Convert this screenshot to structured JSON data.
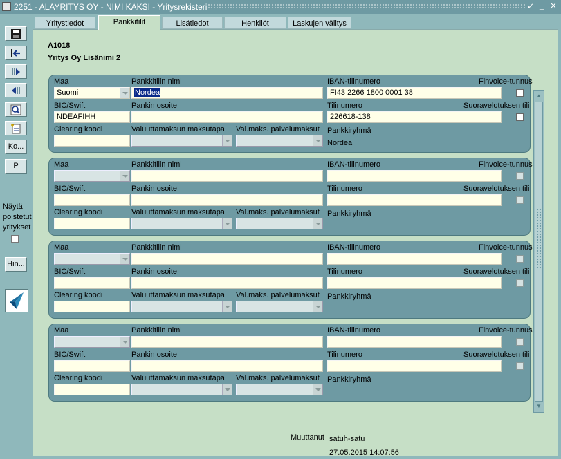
{
  "titlebar": {
    "title": "2251 - ALAYRITYS OY - NIMI KAKSI - Yritysrekisteri",
    "controls": [
      "↙",
      "_",
      "✕"
    ]
  },
  "toolbar": {
    "buttons": [
      {
        "name": "save-button",
        "icon": "save-icon"
      },
      {
        "name": "exit-button",
        "icon": "exit-icon"
      },
      {
        "name": "next-button",
        "icon": "forward-icon"
      },
      {
        "name": "back-button",
        "icon": "back-icon"
      },
      {
        "name": "search-button",
        "icon": "search-icon"
      },
      {
        "name": "new-record-button",
        "icon": "new-document-icon"
      }
    ],
    "ko_label": "Ko...",
    "p_label": "P",
    "show_deleted_label": "Näytä poistetut yritykset",
    "hin_label": "Hin..."
  },
  "tabs": [
    "Yritystiedot",
    "Pankkitilit",
    "Lisätiedot",
    "Henkilöt",
    "Laskujen välitys"
  ],
  "active_tab": 1,
  "header": {
    "code": "A1018",
    "name": "Yritys Oy Lisänimi 2"
  },
  "labels": {
    "maa": "Maa",
    "pankkitilin_nimi": "Pankkitilin nimi",
    "iban": "IBAN-tilinumero",
    "finvoice": "Finvoice-tunnus",
    "bic": "BIC/Swift",
    "pankin_osoite": "Pankin osoite",
    "tilinumero": "Tilinumero",
    "suoraveloitus": "Suoravelotuksen tili",
    "clearing": "Clearing koodi",
    "valuutta": "Valuuttamaksun maksutapa",
    "palvelumaksut": "Val.maks. palvelumaksut",
    "pankkiryhma": "Pankkiryhmä"
  },
  "accounts": [
    {
      "maa": "Suomi",
      "pankkitilin_nimi": "Nordea",
      "iban": "FI43 2266 1800 0001 38",
      "bic": "NDEAFIHH",
      "pankin_osoite": "",
      "tilinumero": "226618-138",
      "clearing": "",
      "valuutta": "",
      "palvelumaksut": "",
      "pankkiryhma": "Nordea"
    },
    {
      "maa": "",
      "pankkitilin_nimi": "",
      "iban": "",
      "bic": "",
      "pankin_osoite": "",
      "tilinumero": "",
      "clearing": "",
      "valuutta": "",
      "palvelumaksut": "",
      "pankkiryhma": ""
    },
    {
      "maa": "",
      "pankkitilin_nimi": "",
      "iban": "",
      "bic": "",
      "pankin_osoite": "",
      "tilinumero": "",
      "clearing": "",
      "valuutta": "",
      "palvelumaksut": "",
      "pankkiryhma": ""
    },
    {
      "maa": "",
      "pankkitilin_nimi": "",
      "iban": "",
      "bic": "",
      "pankin_osoite": "",
      "tilinumero": "",
      "clearing": "",
      "valuutta": "",
      "palvelumaksut": "",
      "pankkiryhma": ""
    }
  ],
  "footer": {
    "changed_by_label": "Muuttanut",
    "changed_by": "satuh-satu",
    "changed_at": "27.05.2015 14:07:56"
  },
  "colors": {
    "frame": "#8fb8bb",
    "content": "#c6dfc6",
    "panel": "#6e9aa3",
    "field": "#ffffe8",
    "selection": "#0a2a8a"
  }
}
